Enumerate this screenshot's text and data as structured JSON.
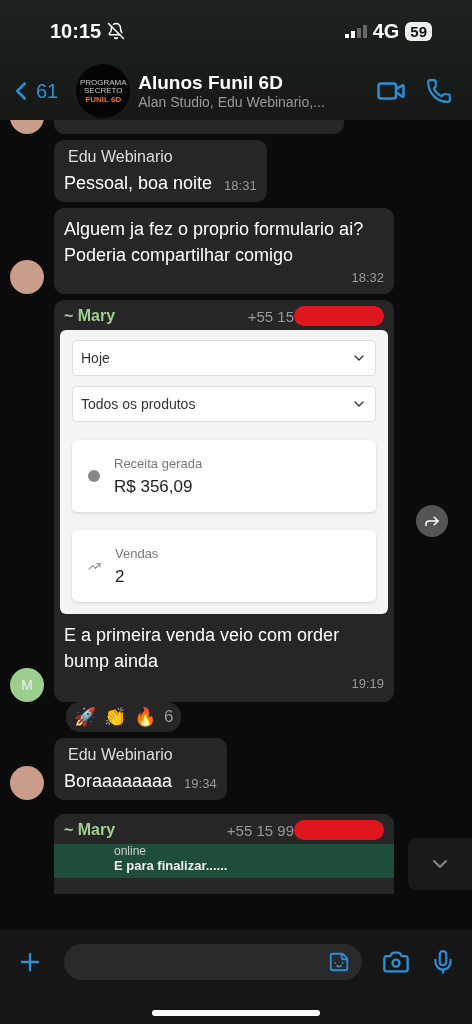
{
  "status_bar": {
    "time": "10:15",
    "network": "4G",
    "battery": "59"
  },
  "header": {
    "back_count": "61",
    "avatar_text": [
      "PROGRAMA SECRETO",
      "FUNIL 6D"
    ],
    "title": "Alunos Funil 6D",
    "subtitle": "Alan Studio, Edu Webinario,..."
  },
  "messages": [
    {
      "kind": "fragment",
      "avatar": true
    },
    {
      "kind": "text",
      "sender": "Edu Webinario",
      "text": "Pessoal, boa noite",
      "time": "18:31",
      "avatar": false
    },
    {
      "kind": "text",
      "text": "Alguem ja fez o proprio formulario ai? Poderia compartilhar comigo",
      "time": "18:32",
      "avatar": true
    },
    {
      "kind": "image",
      "sender": "~ Mary",
      "phone": "+55 15",
      "redacted": true,
      "image": {
        "selects": [
          "Hoje",
          "Todos os produtos"
        ],
        "cards": [
          {
            "label": "Receita gerada",
            "value": "R$ 356,09"
          },
          {
            "label": "Vendas",
            "value": "2"
          }
        ]
      },
      "text": "E a primeira venda veio com order bump ainda",
      "time": "19:19",
      "avatar": true,
      "avatar_text": "M",
      "reactions": [
        "🚀",
        "👏",
        "🔥"
      ],
      "reaction_count": "6"
    },
    {
      "kind": "text",
      "sender": "Edu Webinario",
      "text": "Boraaaaaaaa",
      "time": "19:34",
      "avatar": true
    },
    {
      "kind": "cut",
      "sender": "~ Mary",
      "phone": "+55 15 99",
      "redacted": true,
      "inner_status": "online",
      "inner_text": "E para finalizar......",
      "avatar": false
    }
  ]
}
